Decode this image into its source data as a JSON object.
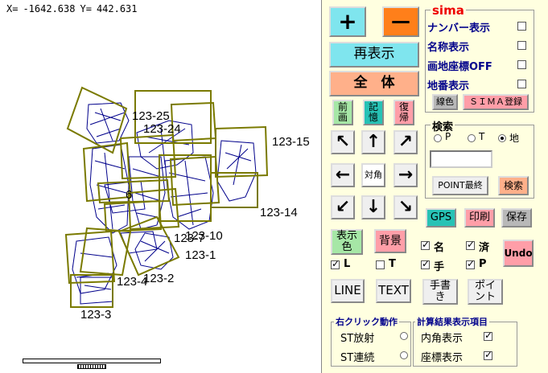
{
  "coords": {
    "x_label": "X=",
    "x_value": "-1642.638",
    "y_label": "Y=",
    "y_value": "442.631"
  },
  "parcels": [
    "123-25",
    "123-24",
    "123-15",
    "123-14",
    "123-10",
    "123-7",
    "123-1",
    "123-2",
    "123-4",
    "123-3",
    "6"
  ],
  "zoom": {
    "plus": "+",
    "minus": "—"
  },
  "buttons": {
    "redisplay": "再表示",
    "whole": "全　体",
    "prev": "前\n画",
    "memory": "記\n憶",
    "restore": "復\n帰",
    "line_color": "線色",
    "sima_register": "ＳＩＭＡ登録",
    "diagonal": "対角",
    "point_last": "POINT最終",
    "search": "検索",
    "gps": "GPS",
    "print": "印刷",
    "save": "保存",
    "display_color": "表示\n色",
    "background": "背景",
    "undo": "Undo",
    "line": "LINE",
    "text": "TEXT",
    "handwrite": "手書\nき",
    "point": "ポイ\nント"
  },
  "arrows": {
    "ul": "↖",
    "up": "↑",
    "ur": "↗",
    "left": "←",
    "right": "→",
    "dl": "↙",
    "down": "↓",
    "dr": "↘"
  },
  "sima": {
    "title": "sima",
    "items": [
      {
        "label": "ナンバー表示",
        "checked": false
      },
      {
        "label": "名称表示",
        "checked": false
      },
      {
        "label": "画地座標OFF",
        "checked": false
      },
      {
        "label": "地番表示",
        "checked": false
      }
    ]
  },
  "search_group": {
    "title": "検索",
    "options": [
      {
        "label": "P",
        "selected": false
      },
      {
        "label": "T",
        "selected": false
      },
      {
        "label": "地",
        "selected": true
      }
    ],
    "input_value": ""
  },
  "toggles": {
    "name": {
      "label": "名",
      "checked": true
    },
    "done": {
      "label": "済",
      "checked": true
    },
    "l": {
      "label": "L",
      "checked": true
    },
    "t": {
      "label": "T",
      "checked": false
    },
    "hand": {
      "label": "手",
      "checked": true
    },
    "p": {
      "label": "P",
      "checked": true
    }
  },
  "right_click": {
    "title": "右クリック動作",
    "options": [
      {
        "label": "ST放射",
        "selected": false
      },
      {
        "label": "ST連続",
        "selected": false
      }
    ]
  },
  "calc_result": {
    "title": "計算結果表示項目",
    "items": [
      {
        "label": "内角表示",
        "checked": true
      },
      {
        "label": "座標表示",
        "checked": true
      }
    ]
  },
  "colors": {
    "frame": "#7a7a00",
    "lines": "#00008b"
  }
}
